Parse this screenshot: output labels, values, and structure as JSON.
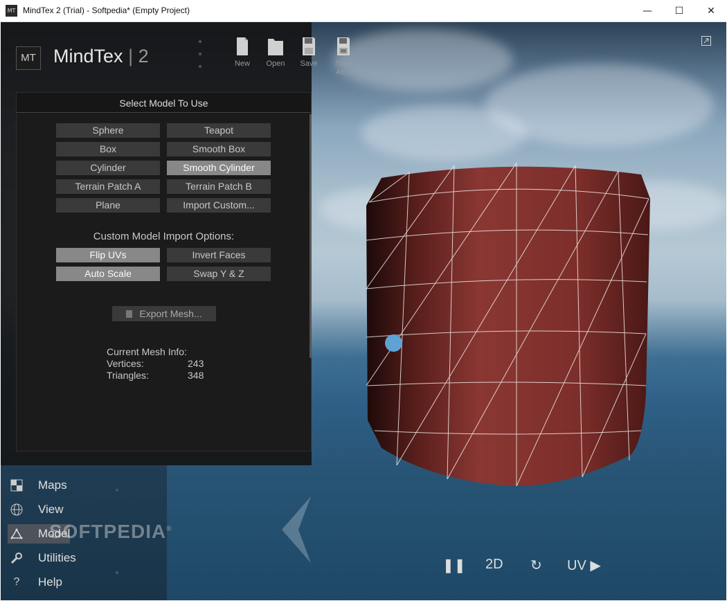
{
  "window": {
    "title": "MindTex 2 (Trial) - Softpedia* (Empty Project)",
    "app_icon": "MT",
    "controls": {
      "minimize": "—",
      "maximize": "☐",
      "close": "✕"
    }
  },
  "logo": {
    "mark": "MT",
    "name": "MindTex",
    "separator": "|",
    "version": "2"
  },
  "toolbar": [
    {
      "id": "new",
      "label": "New",
      "icon": "new-file-icon"
    },
    {
      "id": "open",
      "label": "Open",
      "icon": "open-folder-icon"
    },
    {
      "id": "save",
      "label": "Save",
      "icon": "save-icon"
    },
    {
      "id": "save_as",
      "label": "Save As...",
      "icon": "save-as-icon"
    }
  ],
  "model_panel": {
    "header": "Select Model To Use",
    "models": [
      {
        "label": "Sphere",
        "selected": false
      },
      {
        "label": "Teapot",
        "selected": false
      },
      {
        "label": "Box",
        "selected": false
      },
      {
        "label": "Smooth Box",
        "selected": false
      },
      {
        "label": "Cylinder",
        "selected": false
      },
      {
        "label": "Smooth Cylinder",
        "selected": true
      },
      {
        "label": "Terrain Patch A",
        "selected": false
      },
      {
        "label": "Terrain Patch B",
        "selected": false
      },
      {
        "label": "Plane",
        "selected": false
      },
      {
        "label": "Import Custom...",
        "selected": false
      }
    ],
    "import_options_label": "Custom Model Import Options:",
    "import_options": [
      {
        "label": "Flip UVs",
        "active": true
      },
      {
        "label": "Invert Faces",
        "active": false
      },
      {
        "label": "Auto Scale",
        "active": true
      },
      {
        "label": "Swap Y & Z",
        "active": false
      }
    ],
    "export_label": "Export Mesh...",
    "mesh_info": {
      "title": "Current Mesh Info:",
      "vertices_label": "Vertices:",
      "vertices": "243",
      "triangles_label": "Triangles:",
      "triangles": "348"
    }
  },
  "nav": [
    {
      "label": "Maps",
      "icon": "maps-icon",
      "active": false
    },
    {
      "label": "View",
      "icon": "globe-icon",
      "active": false
    },
    {
      "label": "Model",
      "icon": "model-icon",
      "active": true
    },
    {
      "label": "Utilities",
      "icon": "wrench-icon",
      "active": false
    },
    {
      "label": "Help",
      "icon": "help-icon",
      "active": false
    }
  ],
  "watermark": "SOFTPEDIA",
  "watermark_mark": "®",
  "viewport_controls": {
    "pause": "❚❚",
    "mode_2d": "2D",
    "reset": "↻",
    "uv": "UV ▶"
  },
  "colors": {
    "accent_handle": "#5fa3d6",
    "mesh": "#8a3530",
    "panel": "#1b1b1b"
  }
}
